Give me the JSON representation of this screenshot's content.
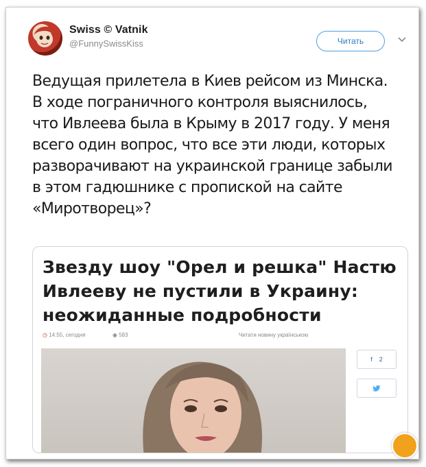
{
  "tweet": {
    "author_name": "Swiss © Vatnik",
    "author_handle": "@FunnySwissKiss",
    "follow_label": "Читать",
    "text": "Ведущая прилетела в Киев рейсом из Минска. В ходе пограничного контроля выяснилось, что Ивлеева была в Крыму в 2017 году. У меня всего один вопрос, что все эти люди, которых разворачивают на украинской границе забыли в этом гадюшнике с пропиской на сайте «Миротворец»?"
  },
  "card": {
    "headline": "Звезду шоу \"Орел и решка\" Настю Ивлееву не пустили в Украину: неожиданные подробности",
    "time": "14:55, сегодня",
    "views": "583",
    "ukrainian_link": "Читати новину українською",
    "facebook_count": "2",
    "facebook_icon": "f"
  },
  "colors": {
    "follow_border": "#4d9ee6",
    "time_icon": "#c0392b",
    "watermark": "#f0a21d"
  }
}
